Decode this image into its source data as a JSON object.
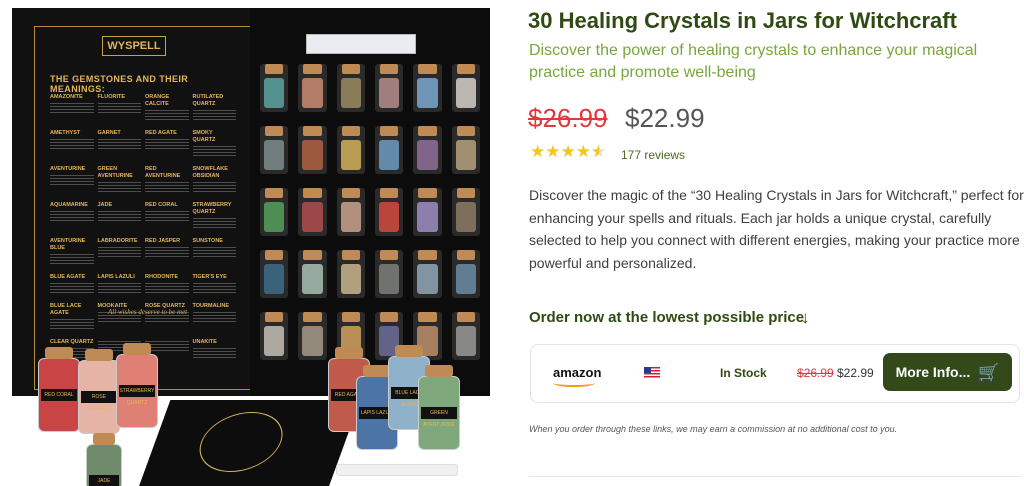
{
  "product": {
    "title": "30 Healing Crystals in Jars for Witchcraft",
    "subtitle": "Discover the power of healing crystals to enhance your magical practice and promote well-being",
    "old_price": "$26.99",
    "new_price": "$22.99",
    "rating": 4.5,
    "reviews": "177 reviews",
    "description": "Discover the magic of the “30 Healing Crystals in Jars for Witchcraft,” perfect for enhancing your spells and rituals. Each jar holds a unique crystal, carefully selected to help you connect with different energies, making your practice more powerful and personalized."
  },
  "order": {
    "heading": "Order now at the lowest possible price",
    "store": "amazon",
    "stock": "In Stock",
    "old_price": "$26.99",
    "new_price": "$22.99",
    "button": "More Info...",
    "disclaimer": "When you order through these links, we may earn a commission at no additional cost to you."
  },
  "image": {
    "brand": "WYSPELL",
    "heading": "THE GEMSTONES AND THEIR MEANINGS:",
    "gems": [
      "AMAZONITE",
      "FLUORITE",
      "ORANGE CALCITE",
      "RUTILATED QUARTZ",
      "AMETHYST",
      "GARNET",
      "RED AGATE",
      "SMOKY QUARTZ",
      "AVENTURINE",
      "GREEN AVENTURINE",
      "RED AVENTURINE",
      "SNOWFLAKE OBSIDIAN",
      "AQUAMARINE",
      "JADE",
      "RED CORAL",
      "STRAWBERRY QUARTZ",
      "AVENTURINE BLUE",
      "LABRADORITE",
      "RED JASPER",
      "SUNSTONE",
      "BLUE AGATE",
      "LAPIS LAZULI",
      "RHODONITE",
      "TIGER'S EYE",
      "BLUE LACE AGATE",
      "MOOKAITE",
      "ROSE QUARTZ",
      "TOURMALINE",
      "CLEAR QUARTZ",
      "",
      "",
      "UNAKITE"
    ],
    "motto": "All wishes deserve to be met",
    "jar_labels": [
      "RED CORAL",
      "ROSE QUARTZ",
      "STRAWBERRY QUARTZ",
      "JADE",
      "RED AGATE",
      "LAPIS LAZULI",
      "BLUE LACE AGATE",
      "GREEN AVENTURINE"
    ]
  },
  "colors": {
    "title": "#2f4a12",
    "subtitle": "#78a73b",
    "old_price": "#dd3a3a",
    "star": "#f5c520",
    "button": "#33491a"
  }
}
